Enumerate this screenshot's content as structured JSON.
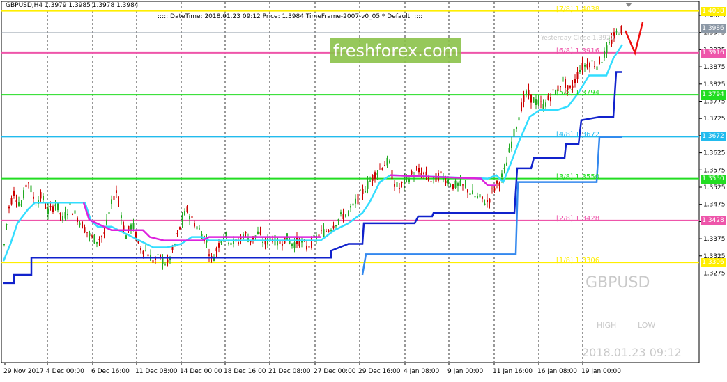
{
  "header": {
    "symbol_line": "GBPUSD,H4  1.3979 1.3985 1.3978 1.3984",
    "info_line": "::::: DateTime: 2018.01.23 09:12    Price: 1.3984   TimeFrame-2007-v0_05    *  Default  :::::"
  },
  "logo": "freshforex.com",
  "watermark": {
    "symbol": "GBPUSD",
    "high_label": "HIGH",
    "low_label": "LOW",
    "timestamp": "2018.01.23 09:12"
  },
  "yesterday_close": "Yesterday Close 1.3920",
  "colors": {
    "bull_candle": "#22aa22",
    "bear_candle": "#cc0000",
    "cyan_line": "#33ddff",
    "magenta_line": "#dd22dd",
    "navy_line": "#1122cc",
    "blue_line": "#3388ee",
    "yellow_level": "#ffee00",
    "pink_level": "#ee55aa",
    "green_level": "#22dd22",
    "cyan_level": "#22bbee"
  },
  "price_axis": [
    "1.4025",
    "1.3975",
    "1.3925",
    "1.3875",
    "1.3825",
    "1.3775",
    "1.3725",
    "1.3675",
    "1.3625",
    "1.3575",
    "1.3525",
    "1.3475",
    "1.3425",
    "1.3375",
    "1.3325",
    "1.3275"
  ],
  "time_axis": [
    "29 Nov 2017",
    "4 Dec 00:00",
    "6 Dec 16:00",
    "11 Dec 08:00",
    "14 Dec 00:00",
    "18 Dec 16:00",
    "21 Dec 08:00",
    "27 Dec 00:00",
    "29 Dec 16:00",
    "4 Jan 08:00",
    "9 Jan 00:00",
    "11 Jan 16:00",
    "16 Jan 08:00",
    "19 Jan 00:00"
  ],
  "murrey_levels": [
    {
      "label": "[7/8]",
      "price": "1.4038",
      "color": "#ffee00"
    },
    {
      "label": "[6/8]",
      "price": "1.3916",
      "color": "#ee55aa"
    },
    {
      "label": "[5/8]",
      "price": "1.3794",
      "color": "#22dd22"
    },
    {
      "label": "[4/8]",
      "price": "1.3672",
      "color": "#22bbee"
    },
    {
      "label": "[3/8]",
      "price": "1.3550",
      "color": "#22dd22"
    },
    {
      "label": "[2/8]",
      "price": "1.3428",
      "color": "#ee55aa"
    },
    {
      "label": "[1/8]",
      "price": "1.3306",
      "color": "#ffee00"
    }
  ],
  "price_tags": [
    {
      "value": "1.4038",
      "color": "#ffee00"
    },
    {
      "value": "1.3986",
      "color": "#8c98a6"
    },
    {
      "value": "1.3916",
      "color": "#ee55aa"
    },
    {
      "value": "1.3794",
      "color": "#22dd22"
    },
    {
      "value": "1.3672",
      "color": "#22bbee"
    },
    {
      "value": "1.3550",
      "color": "#22dd22"
    },
    {
      "value": "1.3428",
      "color": "#ee55aa"
    },
    {
      "value": "1.3306",
      "color": "#ffee00"
    }
  ]
}
